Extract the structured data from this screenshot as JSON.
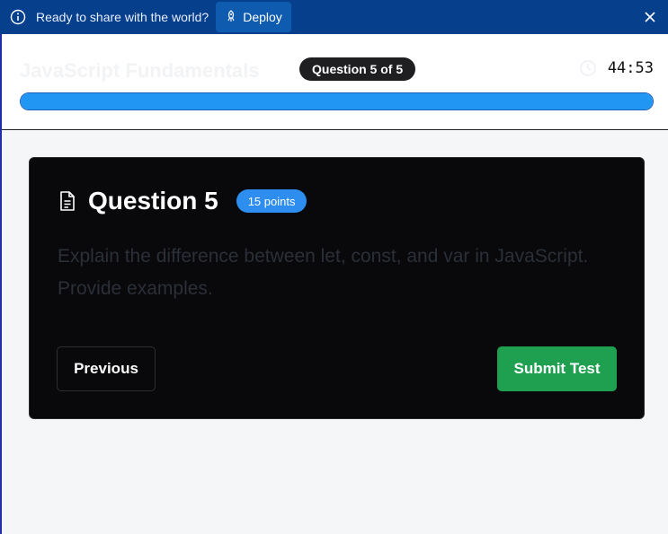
{
  "banner": {
    "message": "Ready to share with the world?",
    "deploy_label": "Deploy",
    "info_icon": "info-circle-icon",
    "deploy_icon": "rocket-icon",
    "close_icon": "close-icon",
    "background": "#063f8c"
  },
  "header": {
    "course_title": "JavaScript Fundamentals",
    "question_badge": "Question 5 of 5",
    "timer": "44:53",
    "timer_icon": "clock-icon",
    "progress_percent": 100,
    "progress_color": "#2196f3"
  },
  "question": {
    "icon": "document-icon",
    "title": "Question 5",
    "points": "15 points",
    "text": "Explain the difference between let, const, and var in JavaScript. Provide examples."
  },
  "actions": {
    "previous_label": "Previous",
    "submit_label": "Submit Test",
    "submit_color": "#1ea050"
  }
}
